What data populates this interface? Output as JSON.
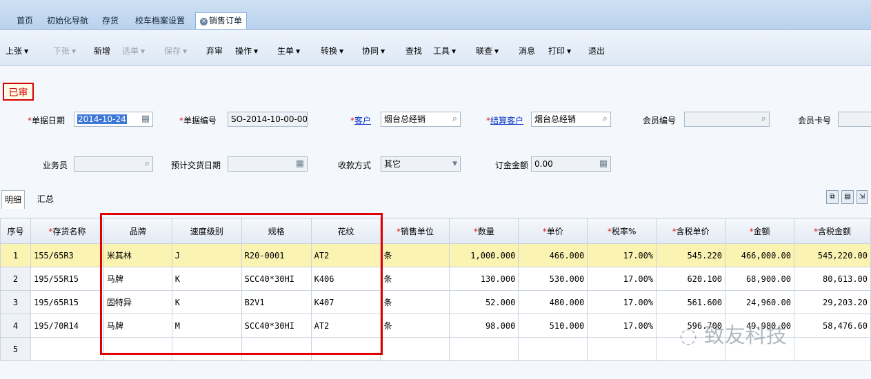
{
  "tabs": [
    {
      "label": "首页",
      "active": false
    },
    {
      "label": "初始化导航",
      "active": false
    },
    {
      "label": "存货",
      "active": false
    },
    {
      "label": "校车档案设置",
      "active": false
    },
    {
      "label": "销售订单",
      "active": true
    }
  ],
  "toolbar": [
    {
      "label": "上张",
      "caret": true,
      "disabled": false
    },
    {
      "label": "下张",
      "caret": true,
      "disabled": true
    },
    {
      "label": "新增",
      "caret": false,
      "disabled": false
    },
    {
      "label": "选单",
      "caret": true,
      "disabled": true
    },
    {
      "label": "保存",
      "caret": true,
      "disabled": true
    },
    {
      "label": "弃审",
      "caret": false,
      "disabled": false
    },
    {
      "label": "操作",
      "caret": true,
      "disabled": false
    },
    {
      "label": "生单",
      "caret": true,
      "disabled": false
    },
    {
      "label": "转换",
      "caret": true,
      "disabled": false
    },
    {
      "label": "协同",
      "caret": true,
      "disabled": false
    },
    {
      "label": "查找",
      "caret": false,
      "disabled": false
    },
    {
      "label": "工具",
      "caret": true,
      "disabled": false
    },
    {
      "label": "联查",
      "caret": true,
      "disabled": false
    },
    {
      "label": "消息",
      "caret": false,
      "disabled": false
    },
    {
      "label": "打印",
      "caret": true,
      "disabled": false
    },
    {
      "label": "退出",
      "caret": false,
      "disabled": false
    }
  ],
  "status": "已审",
  "form": {
    "date_label": "单据日期",
    "date_value": "2014-10-24",
    "docno_label": "单据编号",
    "docno_value": "SO-2014-10-00-00...",
    "customer_label": "客户",
    "customer_value": "烟台总经销",
    "settle_label": "结算客户",
    "settle_value": "烟台总经销",
    "member_no_label": "会员编号",
    "member_no_value": "",
    "member_card_label": "会员卡号",
    "member_card_value": "",
    "salesman_label": "业务员",
    "salesman_value": "",
    "delivery_label": "预计交货日期",
    "delivery_value": "",
    "payment_label": "收款方式",
    "payment_value": "其它",
    "deposit_label": "订金金额",
    "deposit_value": "0.00"
  },
  "subtabs": [
    {
      "label": "明细",
      "active": true
    },
    {
      "label": "汇总",
      "active": false
    }
  ],
  "grid": {
    "columns": [
      {
        "label": "序号",
        "req": false
      },
      {
        "label": "存货名称",
        "req": true
      },
      {
        "label": "品牌",
        "req": false
      },
      {
        "label": "速度级别",
        "req": false
      },
      {
        "label": "规格",
        "req": false
      },
      {
        "label": "花纹",
        "req": false
      },
      {
        "label": "销售单位",
        "req": true
      },
      {
        "label": "数量",
        "req": true
      },
      {
        "label": "单价",
        "req": true
      },
      {
        "label": "税率%",
        "req": true
      },
      {
        "label": "含税单价",
        "req": true
      },
      {
        "label": "金额",
        "req": true
      },
      {
        "label": "含税金额",
        "req": true
      }
    ],
    "rows": [
      [
        "1",
        "155/65R3",
        "米其林",
        "J",
        "R20-0001",
        "AT2",
        "条",
        "1,000.000",
        "466.000",
        "17.00%",
        "545.220",
        "466,000.00",
        "545,220.00"
      ],
      [
        "2",
        "195/55R15",
        "马牌",
        "K",
        "SCC40*30HI",
        "K406",
        "条",
        "130.000",
        "530.000",
        "17.00%",
        "620.100",
        "68,900.00",
        "80,613.00"
      ],
      [
        "3",
        "195/65R15",
        "固特异",
        "K",
        "B2V1",
        "K407",
        "条",
        "52.000",
        "480.000",
        "17.00%",
        "561.600",
        "24,960.00",
        "29,203.20"
      ],
      [
        "4",
        "195/70R14",
        "马牌",
        "M",
        "SCC40*30HI",
        "AT2",
        "条",
        "98.000",
        "510.000",
        "17.00%",
        "596.700",
        "49,980.00",
        "58,476.60"
      ],
      [
        "5",
        "",
        "",
        "",
        "",
        "",
        "",
        "",
        "",
        "",
        "",
        "",
        ""
      ]
    ]
  },
  "watermark": "致友科技"
}
